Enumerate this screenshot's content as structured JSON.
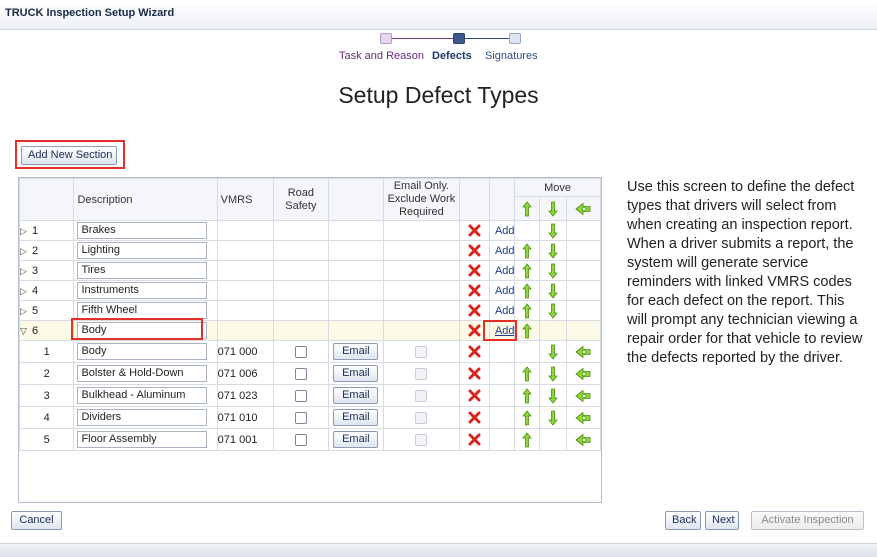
{
  "window": {
    "title": "TRUCK Inspection Setup Wizard"
  },
  "steps": [
    {
      "label": "Task and Reason",
      "state": "visited"
    },
    {
      "label": "Defects",
      "state": "active"
    },
    {
      "label": "Signatures",
      "state": "future"
    }
  ],
  "page_title": "Setup Defect Types",
  "add_section_label": "Add New Section",
  "columns": {
    "description": "Description",
    "vmrs": "VMRS",
    "road_safety": "Road Safety",
    "email_only": "Email Only. Exclude Work Required",
    "move": "Move"
  },
  "sections": [
    {
      "num": "1",
      "name": "Brakes",
      "add": "Add"
    },
    {
      "num": "2",
      "name": "Lighting",
      "add": "Add"
    },
    {
      "num": "3",
      "name": "Tires",
      "add": "Add"
    },
    {
      "num": "4",
      "name": "Instruments",
      "add": "Add"
    },
    {
      "num": "5",
      "name": "Fifth Wheel",
      "add": "Add"
    },
    {
      "num": "6",
      "name": "Body",
      "add": "Add"
    }
  ],
  "defects": [
    {
      "num": "1",
      "name": "Body",
      "vmrs": "071 000",
      "email": "Email"
    },
    {
      "num": "2",
      "name": "Bolster & Hold-Down",
      "vmrs": "071 006",
      "email": "Email"
    },
    {
      "num": "3",
      "name": "Bulkhead - Aluminum",
      "vmrs": "071 023",
      "email": "Email"
    },
    {
      "num": "4",
      "name": "Dividers",
      "vmrs": "071 010",
      "email": "Email"
    },
    {
      "num": "5",
      "name": "Floor Assembly",
      "vmrs": "071 001",
      "email": "Email"
    }
  ],
  "help_text": "Use this screen to define the defect types that drivers will select from when creating an inspection report. When a driver submits a report, the system will generate service reminders with linked VMRS codes for each defect on the report. This will prompt any technician viewing a repair order for that vehicle to review the defects reported by the driver.",
  "buttons": {
    "cancel": "Cancel",
    "back": "Back",
    "next": "Next",
    "activate": "Activate Inspection"
  },
  "icons": {
    "delete": "red-x-icon",
    "move_up": "green-up-arrow-icon",
    "move_down": "green-down-arrow-icon",
    "move_to_section": "green-move-section-icon"
  },
  "colors": {
    "highlight": "#e5302a",
    "link": "#1f3d8e",
    "arrow_green": "#6fbf1e",
    "delete_red": "#d8261e"
  }
}
